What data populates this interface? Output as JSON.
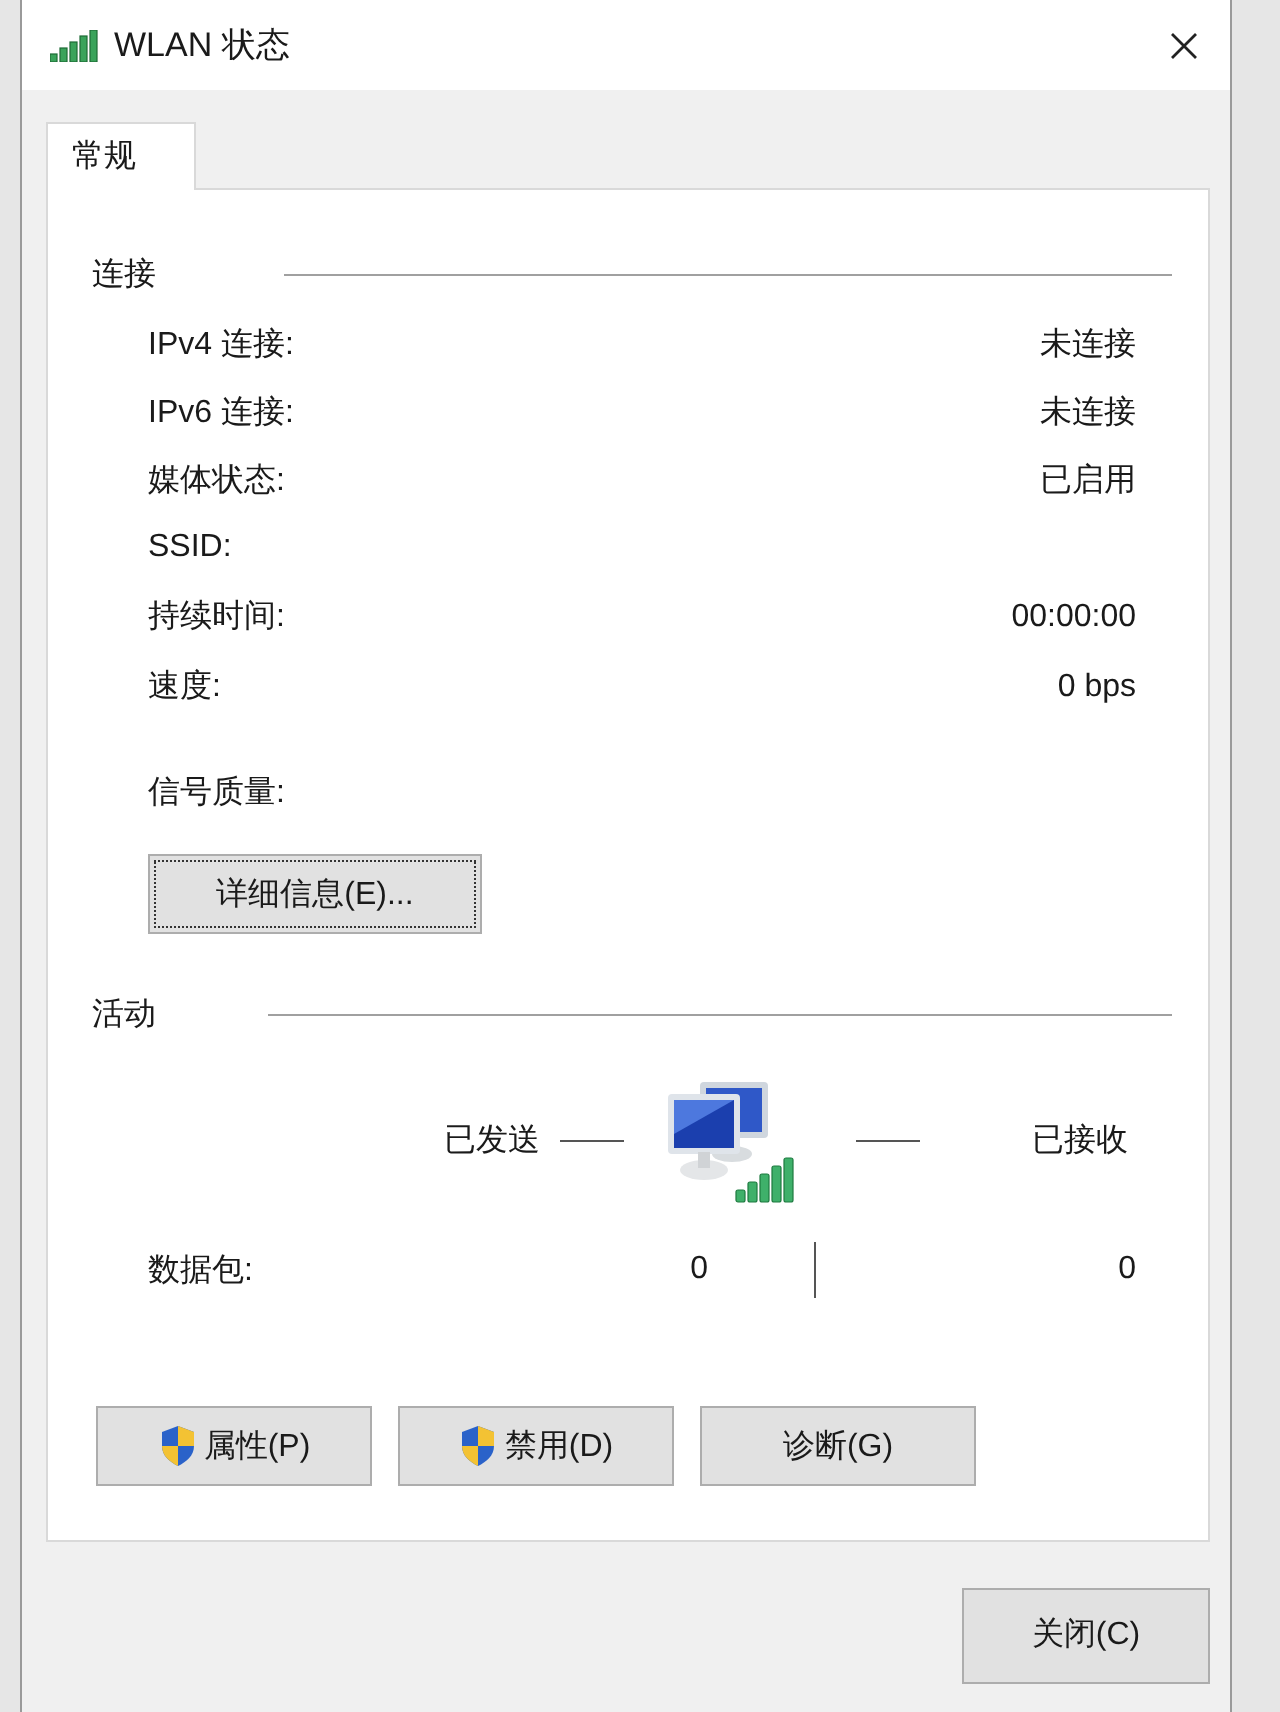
{
  "window": {
    "title": "WLAN 状态"
  },
  "tabs": [
    {
      "label": "常规",
      "selected": true
    }
  ],
  "connection": {
    "heading": "连接",
    "rows": [
      {
        "label": "IPv4 连接:",
        "value": "未连接"
      },
      {
        "label": "IPv6 连接:",
        "value": "未连接"
      },
      {
        "label": "媒体状态:",
        "value": "已启用"
      },
      {
        "label": "SSID:"
      },
      {
        "label": "持续时间:",
        "value": "00:00:00"
      },
      {
        "label": "速度:",
        "value": "0 bps"
      },
      {
        "label": "信号质量:"
      }
    ]
  },
  "details_button": {
    "label": "详细信息(E)...",
    "focused": true
  },
  "activity": {
    "heading": "活动",
    "sent_label": "已发送",
    "received_label": "已接收",
    "rows": [
      {
        "label": "数据包:",
        "sent": "0",
        "received": "0"
      }
    ]
  },
  "buttons": [
    {
      "label": "属性(P)",
      "shield": true
    },
    {
      "label": "禁用(D)",
      "shield": true
    },
    {
      "label": "诊断(G)",
      "shield": false
    }
  ],
  "close_button": {
    "label": "关闭(C)"
  }
}
